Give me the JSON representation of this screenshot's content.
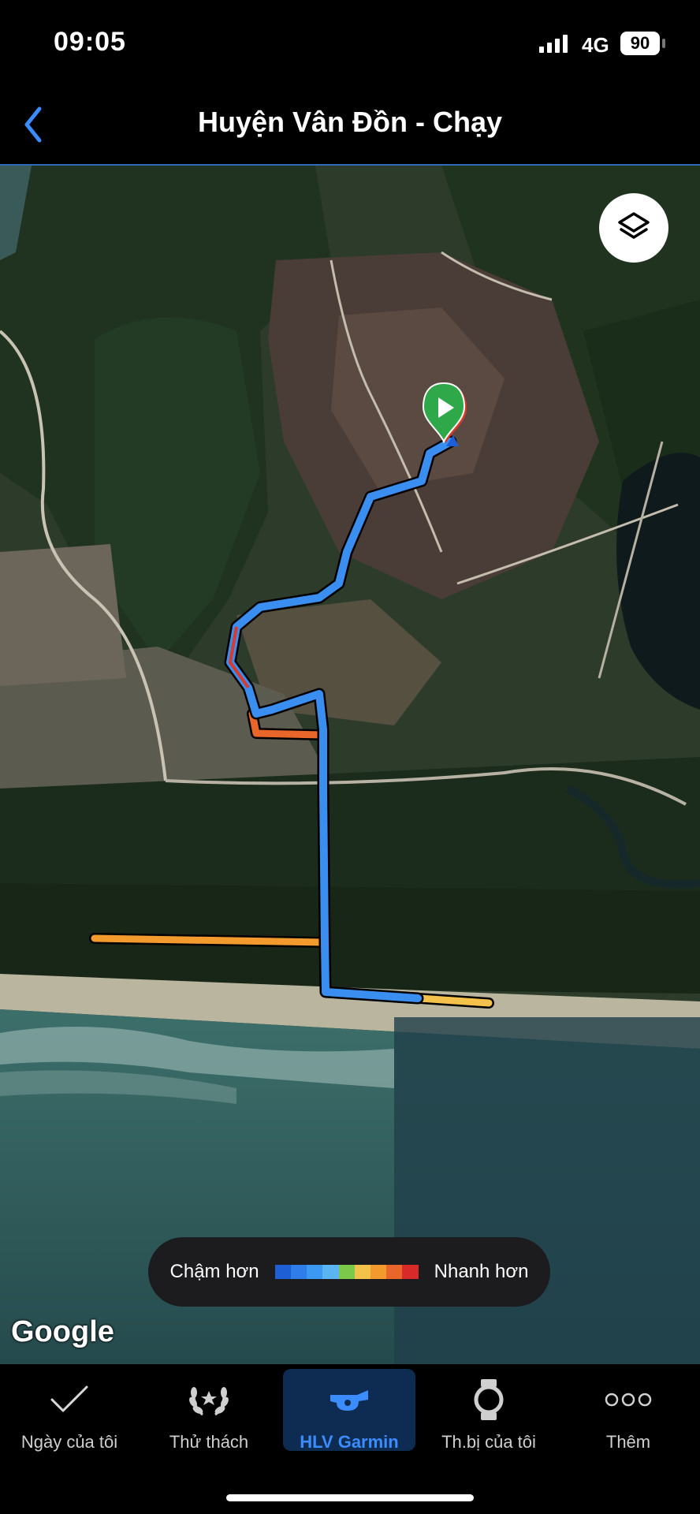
{
  "status_bar": {
    "time": "09:05",
    "network": "4G",
    "battery": "90"
  },
  "header": {
    "title": "Huyện Vân Đồn - Chạy"
  },
  "map": {
    "attribution": "Google",
    "legend": {
      "slower_label": "Chậm hơn",
      "faster_label": "Nhanh hơn",
      "colors": [
        "#1e5fd6",
        "#2f7de8",
        "#3c98f0",
        "#5bb4f2",
        "#7cc84a",
        "#f2c24a",
        "#f29a2e",
        "#e8662a",
        "#d92a2a"
      ]
    },
    "route_colors": {
      "main": "#3a8ef0",
      "fast": "#f29a2e",
      "medium": "#f4c24a",
      "fastest": "#d93a2a"
    }
  },
  "tabs": [
    {
      "label": "Ngày của tôi",
      "icon": "check-icon"
    },
    {
      "label": "Thử thách",
      "icon": "laurel-icon"
    },
    {
      "label": "HLV Garmin",
      "icon": "whistle-icon",
      "active": true
    },
    {
      "label": "Th.bị của tôi",
      "icon": "watch-icon"
    },
    {
      "label": "Thêm",
      "icon": "more-dots-icon"
    }
  ]
}
